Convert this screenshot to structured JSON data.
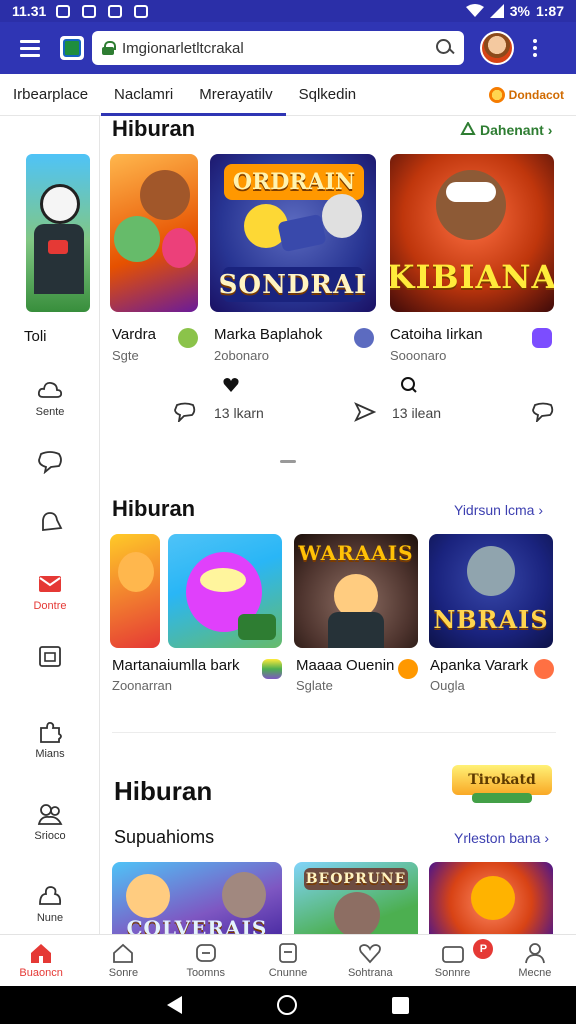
{
  "status_bar": {
    "time": "11.31",
    "right_text": "3%",
    "battery": "1:87"
  },
  "browser": {
    "url": "Imgionarletltcrakal"
  },
  "tabs": [
    {
      "label": "Irbearplace"
    },
    {
      "label": "Naclamri"
    },
    {
      "label": "Mrerayatilv"
    },
    {
      "label": "Sqlkedin"
    }
  ],
  "promo": {
    "label": "Dondacot"
  },
  "sidebar": {
    "top_label": "Toli",
    "items": [
      {
        "label": "Sente",
        "icon": "cloud-icon"
      },
      {
        "label": "",
        "icon": "chat-icon"
      },
      {
        "label": "",
        "icon": "bell-icon"
      },
      {
        "label": "Dontre",
        "icon": "mail-icon",
        "active": true
      },
      {
        "label": "",
        "icon": "calendar-icon"
      },
      {
        "label": "Mians",
        "icon": "puzzle-icon"
      },
      {
        "label": "Srioco",
        "icon": "people-icon"
      },
      {
        "label": "Nune",
        "icon": "group-icon"
      }
    ]
  },
  "section1": {
    "title": "Hiburan",
    "link": "Dahenant",
    "cards": [
      {
        "name": "Vardra",
        "sub": "Sgte",
        "art": "Animal friends"
      },
      {
        "name": "Marka Baplahok",
        "sub": "2obonaro",
        "art": "SONDRAI",
        "logo": "ORDRAIN"
      },
      {
        "name": "Catoiha Iirkan",
        "sub": "Sooonaro",
        "art": "KIBIANA"
      }
    ],
    "stats": [
      {
        "label": "13 lkarn"
      },
      {
        "label": "13 ilean"
      }
    ]
  },
  "section2": {
    "title": "Hiburan",
    "link": "Yidrsun lcma",
    "cards": [
      {
        "name": "Martanaiumlla bark",
        "sub": "Zoonarran"
      },
      {
        "name": "Maaaa Ouenin",
        "sub": "Sglate",
        "art": "WARAAIS"
      },
      {
        "name": "Apanka Varark",
        "sub": "Ougla",
        "art": "NBRAIS"
      }
    ]
  },
  "section3": {
    "title": "Hiburan",
    "logo_text": "Tirokatd",
    "subtitle": "Supuahioms",
    "link": "Yrleston bana",
    "cards": [
      {
        "art": "COLVERAIS"
      },
      {
        "art": "BEOPRUNE"
      },
      {
        "art": ""
      }
    ]
  },
  "bottom_nav": [
    {
      "label": "Buaoncn",
      "icon": "home-icon",
      "active": true
    },
    {
      "label": "Sonre",
      "icon": "home-outline-icon"
    },
    {
      "label": "Toomns",
      "icon": "tokens-icon"
    },
    {
      "label": "Cnunne",
      "icon": "box-icon"
    },
    {
      "label": "Sohtrana",
      "icon": "heart-icon"
    },
    {
      "label": "Sonnre",
      "icon": "camera-icon",
      "badge": "P"
    },
    {
      "label": "Mecne",
      "icon": "person-icon"
    }
  ],
  "colors": {
    "brand": "#2f35b4",
    "accent_red": "#e53935",
    "link_green": "#2e7d32"
  }
}
